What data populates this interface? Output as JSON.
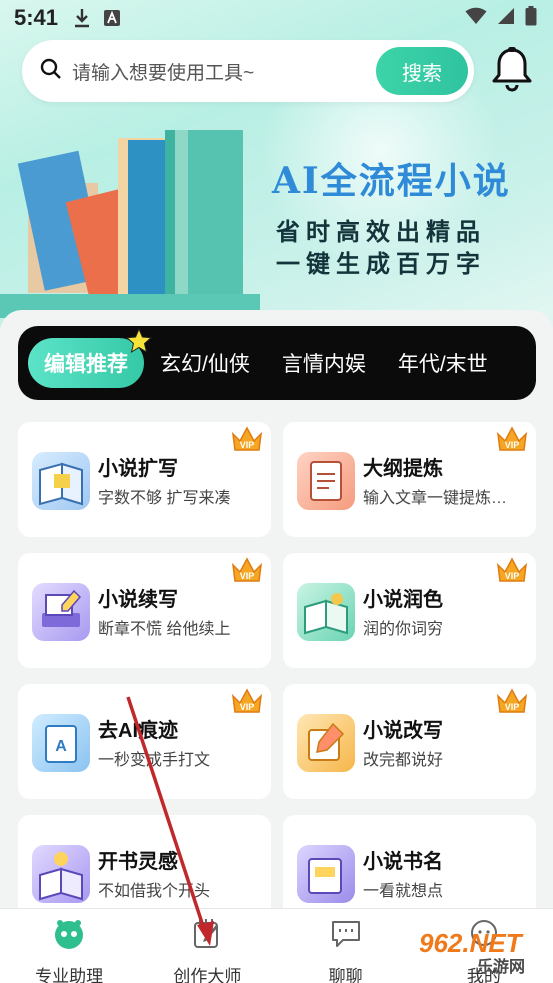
{
  "status_bar": {
    "time": "5:41"
  },
  "search": {
    "placeholder": "请输入想要使用工具~",
    "button_label": "搜索"
  },
  "banner": {
    "title": "AI全流程小说",
    "subtitle_line1": "省时高效出精品",
    "subtitle_line2": "一键生成百万字"
  },
  "categories": [
    {
      "label": "编辑推荐",
      "active": true
    },
    {
      "label": "玄幻/仙侠"
    },
    {
      "label": "言情内娱"
    },
    {
      "label": "年代/末世"
    }
  ],
  "tools": [
    {
      "title": "小说扩写",
      "desc": "字数不够 扩写来凑",
      "icon": "expand-book-icon",
      "vip": true
    },
    {
      "title": "大纲提炼",
      "desc": "输入文章一键提炼…",
      "icon": "outline-icon",
      "vip": true
    },
    {
      "title": "小说续写",
      "desc": "断章不慌 给他续上",
      "icon": "continue-icon",
      "vip": true
    },
    {
      "title": "小说润色",
      "desc": "润的你词穷",
      "icon": "polish-icon",
      "vip": true
    },
    {
      "title": "去AI痕迹",
      "desc": "一秒变成手打文",
      "icon": "de-ai-icon",
      "vip": true
    },
    {
      "title": "小说改写",
      "desc": "改完都说好",
      "icon": "rewrite-icon",
      "vip": true
    },
    {
      "title": "开书灵感",
      "desc": "不如借我个开头",
      "icon": "inspiration-icon",
      "vip": false
    },
    {
      "title": "小说书名",
      "desc": "一看就想点",
      "icon": "title-icon",
      "vip": false
    }
  ],
  "vip_badge": "VIP",
  "tabbar": [
    {
      "label": "专业助理",
      "icon": "assistant-icon"
    },
    {
      "label": "创作大师",
      "icon": "pen-notebook-icon"
    },
    {
      "label": "聊聊",
      "icon": "chat-icon"
    },
    {
      "label": "我的",
      "icon": "profile-icon"
    }
  ],
  "watermark": {
    "text": "962.NET",
    "sub": "乐游网"
  },
  "colors": {
    "accent": "#35c9a6",
    "banner_title": "#2f8bd8",
    "category_bg": "#0b0b0b",
    "vip_orange": "#f5a623",
    "annotation_arrow": "#c0282b"
  }
}
